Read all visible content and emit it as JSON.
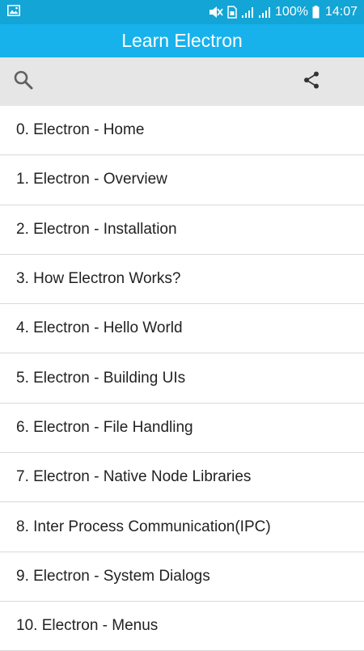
{
  "status_bar": {
    "battery": "100%",
    "time": "14:07",
    "icons": [
      "image-notification-icon",
      "mute-icon",
      "sim-icon",
      "signal-icon",
      "signal-icon"
    ]
  },
  "app_bar": {
    "title": "Learn Electron"
  },
  "toolbar": {
    "search_icon": "search-icon",
    "share_icon": "share-icon"
  },
  "chapters": [
    "0. Electron - Home",
    "1. Electron - Overview",
    "2. Electron - Installation",
    "3. How Electron Works?",
    "4. Electron - Hello World",
    "5. Electron - Building UIs",
    "6. Electron - File Handling",
    "7. Electron - Native Node Libraries",
    "8. Inter Process Communication(IPC)",
    "9. Electron - System Dialogs",
    "10. Electron - Menus"
  ],
  "colors": {
    "status_bar": "#12a5d6",
    "app_bar": "#17b2ec",
    "toolbar": "#e6e6e6"
  }
}
